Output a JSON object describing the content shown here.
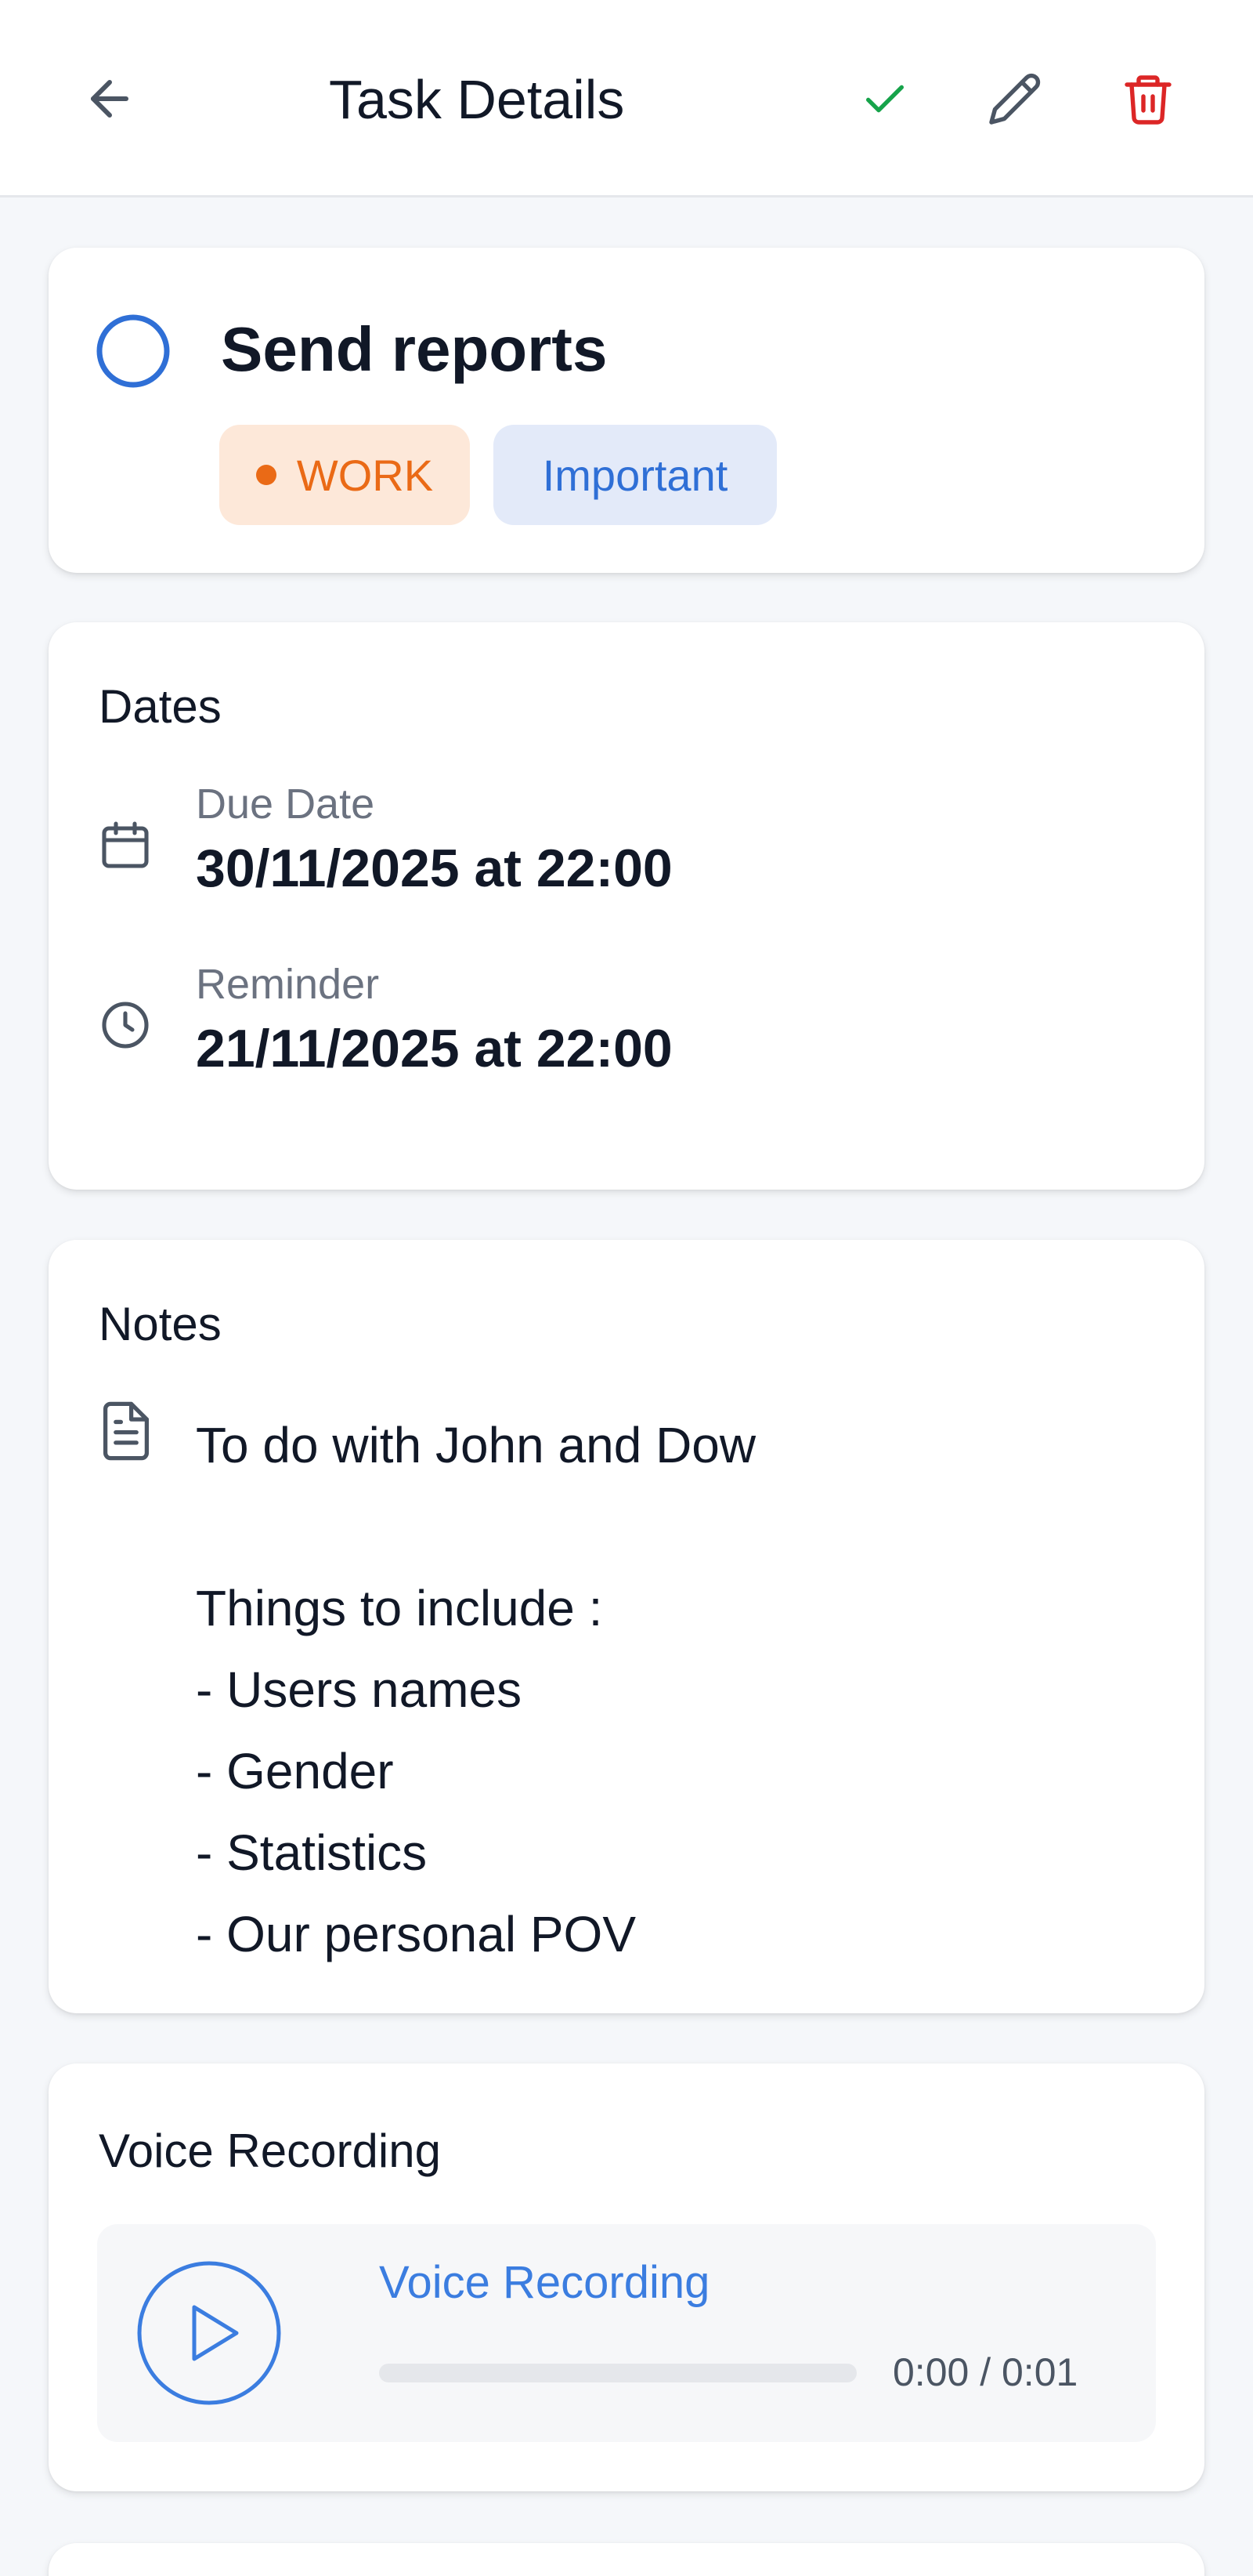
{
  "header": {
    "title": "Task Details",
    "back_icon": "arrow-left-icon",
    "actions": [
      {
        "icon": "check-icon",
        "color": "#16a34a"
      },
      {
        "icon": "pencil-icon",
        "color": "#4b5563"
      },
      {
        "icon": "trash-icon",
        "color": "#dc2626"
      }
    ]
  },
  "task": {
    "title": "Send reports",
    "completed": false,
    "accent_color": "#2f6fd6",
    "category": {
      "label": "WORK",
      "color": "#ea6a16"
    },
    "priority": {
      "label": "Important",
      "color": "#2f6fd6"
    }
  },
  "dates": {
    "title": "Dates",
    "due": {
      "label": "Due Date",
      "value": "30/11/2025 at 22:00",
      "icon": "calendar-icon"
    },
    "reminder": {
      "label": "Reminder",
      "value": "21/11/2025 at 22:00",
      "icon": "clock-icon"
    }
  },
  "notes": {
    "title": "Notes",
    "icon": "document-icon",
    "text": "To do with John and Dow\n\nThings to include :\n- Users names\n- Gender\n- Statistics\n- Our personal POV"
  },
  "voice": {
    "title": "Voice Recording",
    "player_title": "Voice Recording",
    "time": "0:00 / 0:01",
    "progress": 0,
    "accent_color": "#3b7de0"
  }
}
